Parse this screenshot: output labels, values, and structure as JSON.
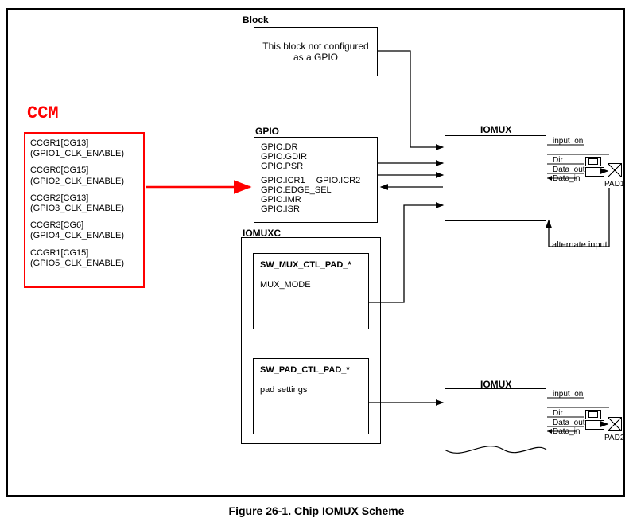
{
  "titles": {
    "block": "Block",
    "gpio": "GPIO",
    "iomuxc": "IOMUXC",
    "iomux": "IOMUX",
    "ccm": "CCM"
  },
  "block_text": "This block not configured as a GPIO",
  "ccm": {
    "items": [
      {
        "reg": "CCGR1[CG13]",
        "desc": "(GPIO1_CLK_ENABLE)"
      },
      {
        "reg": "CCGR0[CG15]",
        "desc": "(GPIO2_CLK_ENABLE)"
      },
      {
        "reg": "CCGR2[CG13]",
        "desc": "(GPIO3_CLK_ENABLE)"
      },
      {
        "reg": "CCGR3[CG6]",
        "desc": "(GPIO4_CLK_ENABLE)"
      },
      {
        "reg": "CCGR1[CG15]",
        "desc": "(GPIO5_CLK_ENABLE)"
      }
    ]
  },
  "gpio": {
    "lines": [
      "GPIO.DR",
      "GPIO.GDIR",
      "GPIO.PSR"
    ],
    "lines2": [
      "GPIO.ICR1",
      "GPIO.EDGE_SEL",
      "GPIO.IMR",
      "GPIO.ISR"
    ],
    "icr2": "GPIO.ICR2"
  },
  "iomuxc": {
    "swmux_title": "SW_MUX_CTL_PAD_*",
    "swmux_body": "MUX_MODE",
    "swpad_title": "SW_PAD_CTL_PAD_*",
    "swpad_body": "pad settings"
  },
  "signals": {
    "input_on": "input_on",
    "dir": "Dir",
    "data_out": "Data_out",
    "data_in": "Data_in",
    "alternate_input": "alternate input"
  },
  "pads": {
    "pad1": "PAD1",
    "pad2": "PAD2"
  },
  "figure_caption": "Figure 26-1. Chip IOMUX Scheme"
}
